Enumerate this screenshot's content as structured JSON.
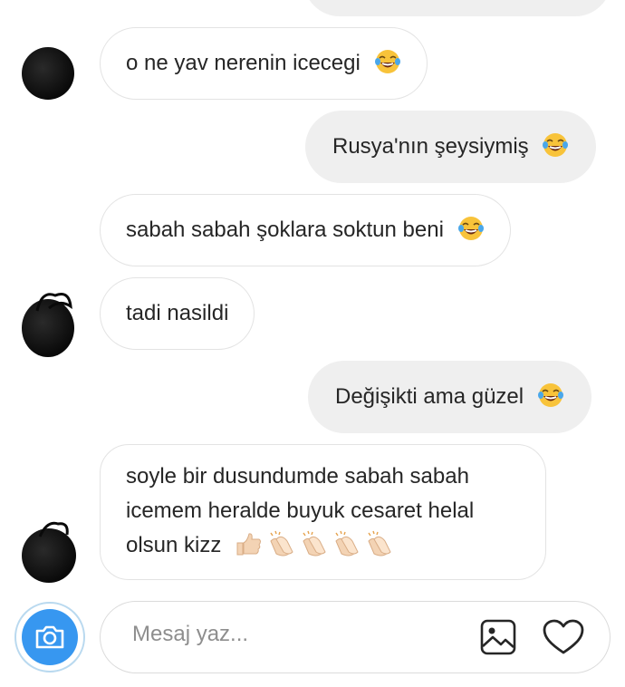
{
  "messages": [
    {
      "side": "in",
      "text": "o ne yav nerenin icecegi",
      "emoji": "😂"
    },
    {
      "side": "out",
      "text": "Rusya'nın şeysiymiş",
      "emoji": "😂"
    },
    {
      "side": "in",
      "text": "sabah sabah şoklara soktun beni",
      "emoji": "😂"
    },
    {
      "side": "in",
      "text": "tadi nasildi",
      "emoji": ""
    },
    {
      "side": "out",
      "text": "Değişikti ama güzel",
      "emoji": "😂"
    },
    {
      "side": "in",
      "text_line1": "soyle bir dusundumde sabah sabah",
      "text_line2": "icemem heralde buyuk cesaret helal",
      "text_line3": "olsun kizz",
      "emoji": "👍🏻👏🏻👏🏻👏🏻👏🏻"
    }
  ],
  "composer": {
    "placeholder": "Mesaj yaz...",
    "camera_icon": "camera-icon",
    "gallery_icon": "image-icon",
    "like_icon": "heart-icon"
  },
  "colors": {
    "incoming_border": "#e3e3e3",
    "outgoing_bg": "#efefef",
    "accent": "#3797f0"
  }
}
